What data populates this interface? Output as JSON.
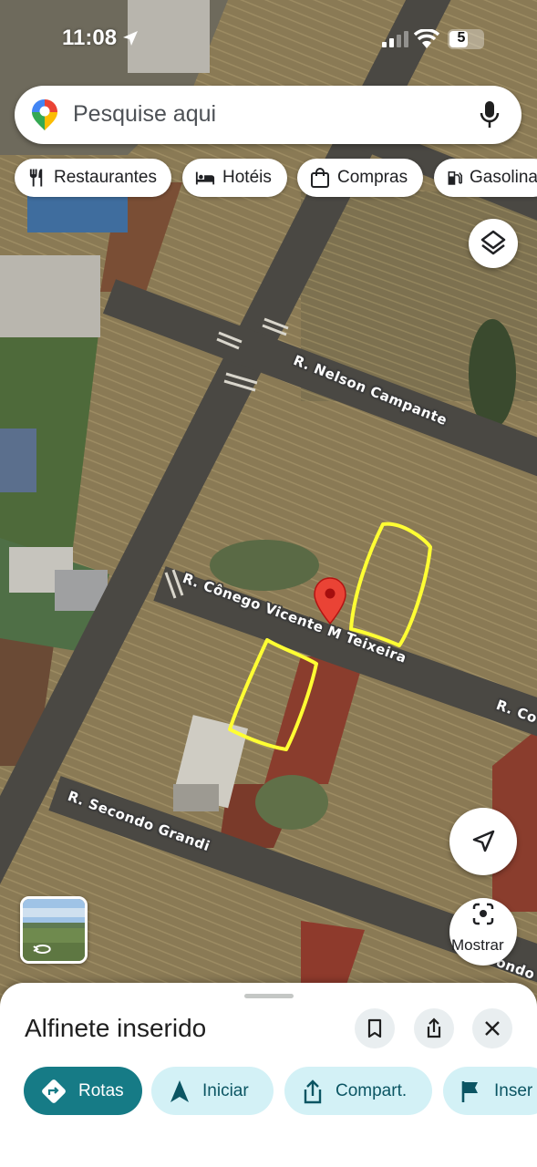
{
  "status_bar": {
    "time": "11:08",
    "battery": "5"
  },
  "search": {
    "placeholder": "Pesquise aqui"
  },
  "chips": [
    {
      "label": "Restaurantes",
      "icon": "restaurant-icon"
    },
    {
      "label": "Hotéis",
      "icon": "bed-icon"
    },
    {
      "label": "Compras",
      "icon": "shopping-bag-icon"
    },
    {
      "label": "Gasolina",
      "icon": "gas-station-icon"
    }
  ],
  "map": {
    "streets": [
      {
        "name": "R. Nelson Campante"
      },
      {
        "name": "R. Cônego Vicente M Teixeira"
      },
      {
        "name": "R. Co"
      },
      {
        "name": "R. Secondo Grandi"
      },
      {
        "name": "ondo"
      }
    ],
    "pin_color": "#ea4335",
    "annotation_color": "#ffff33"
  },
  "lens_button": {
    "label": "Mostrar"
  },
  "sheet": {
    "title": "Alfinete inserido",
    "actions": [
      {
        "label": "Rotas",
        "icon": "directions-icon",
        "primary": true
      },
      {
        "label": "Iniciar",
        "icon": "navigation-arrow-icon"
      },
      {
        "label": "Compart.",
        "icon": "share-icon"
      },
      {
        "label": "Inser",
        "icon": "flag-icon"
      }
    ]
  },
  "colors": {
    "accent": "#167b86",
    "chip_bg": "#d3f1f6"
  }
}
